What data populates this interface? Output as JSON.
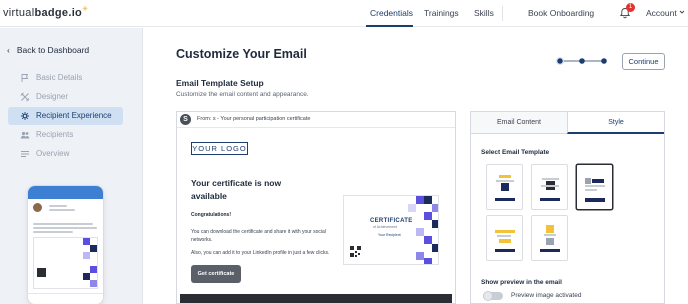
{
  "brand": {
    "name_light": "virtual",
    "name_bold": "badge.io",
    "accent": "#f2a81d"
  },
  "topnav": {
    "links": [
      "Credentials",
      "Trainings",
      "Skills",
      "Book Onboarding"
    ],
    "active": "Credentials",
    "notifications": "1",
    "account": "Account"
  },
  "sidebar": {
    "back": "Back to Dashboard",
    "items": [
      {
        "label": "Basic Details",
        "icon": "flag-icon",
        "active": false
      },
      {
        "label": "Designer",
        "icon": "tools-icon",
        "active": false
      },
      {
        "label": "Recipient Experience",
        "icon": "sparkle-icon",
        "active": true
      },
      {
        "label": "Recipients",
        "icon": "users-icon",
        "active": false
      },
      {
        "label": "Overview",
        "icon": "list-icon",
        "active": false
      }
    ]
  },
  "main": {
    "title": "Customize Your Email",
    "continue": "Continue",
    "stepper": {
      "steps": 3,
      "current": 1
    },
    "section_title": "Email Template Setup",
    "section_sub": "Customize the email content and appearance."
  },
  "email": {
    "from_initial": "S",
    "from": "From: s - Your personal participation certificate",
    "logo": "YOUR LOGO",
    "heading": "Your certificate is now available",
    "congrats": "Congratulations!",
    "para1": "You can download the certificate and share it with your social networks.",
    "para2": "Also, you can add it to your LinkedIn profile in just a few clicks.",
    "button": "Get certificate",
    "cert": {
      "title": "CERTIFICATE",
      "subtitle": "of Achievement",
      "recipient": "Your Recipient"
    }
  },
  "panel": {
    "tabs": [
      "Email Content",
      "Style"
    ],
    "active_tab": "Style",
    "select_label": "Select Email Template",
    "selected_template": 3,
    "preview_label": "Show preview in the email",
    "preview_toggle_label": "Preview image activated",
    "preview_enabled": false
  },
  "colors": {
    "primary": "#1c3d6e",
    "accent_yellow": "#f2c23a",
    "purple": "#5b4fe0",
    "navy": "#1b2a5a"
  }
}
